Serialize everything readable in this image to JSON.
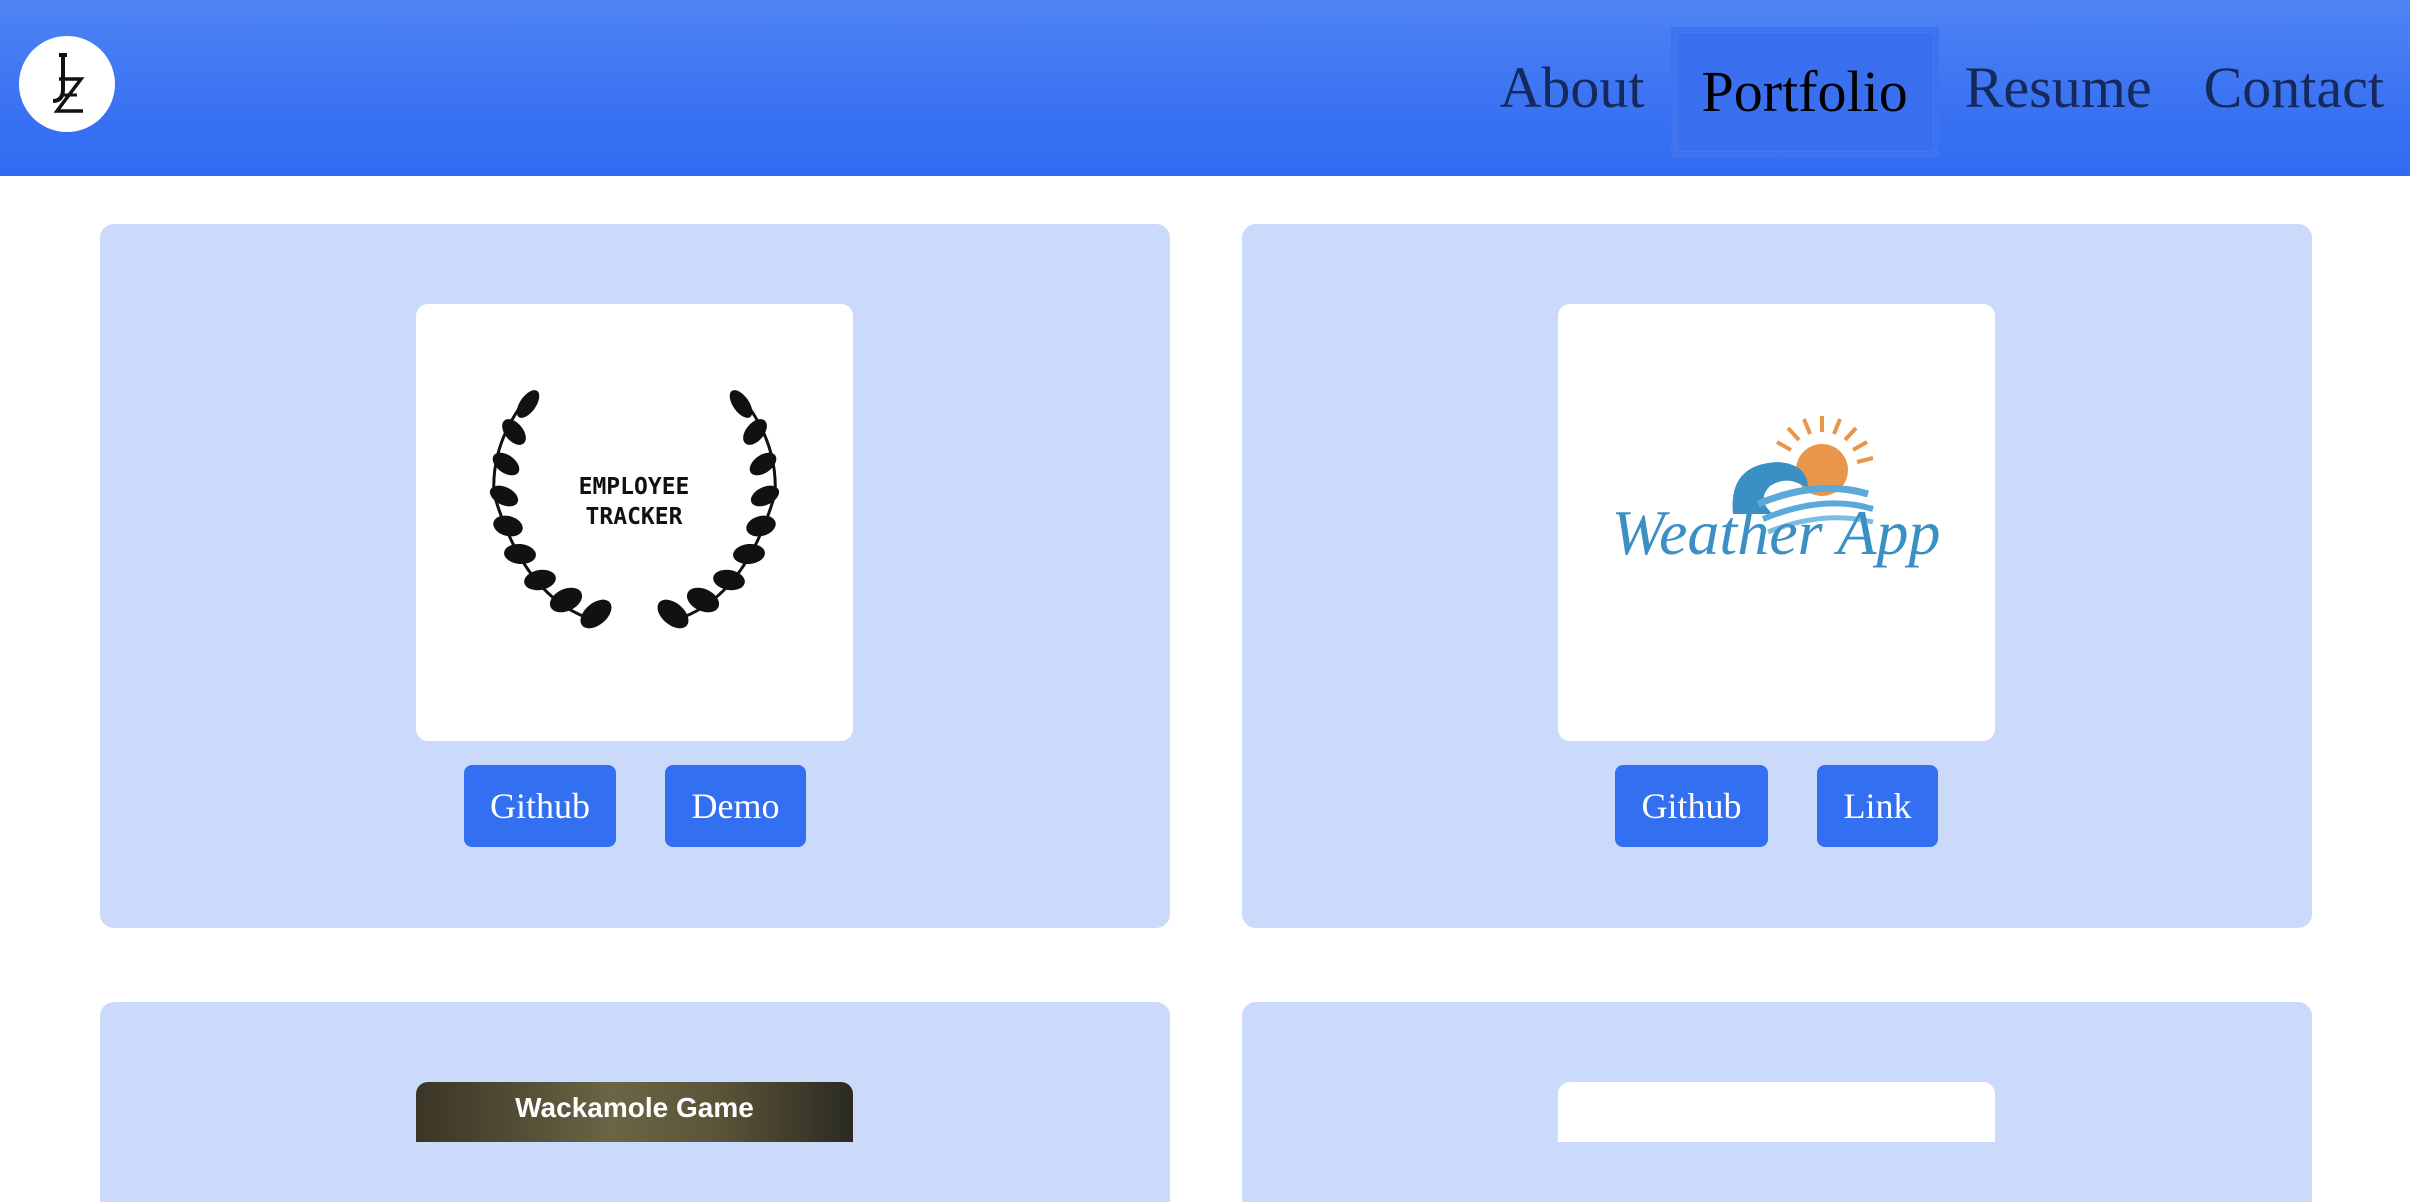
{
  "header": {
    "logo_text": "JZ",
    "nav": [
      {
        "label": "About"
      },
      {
        "label": "Portfolio",
        "active": true
      },
      {
        "label": "Resume"
      },
      {
        "label": "Contact"
      }
    ]
  },
  "projects": [
    {
      "logo_lines": [
        "EMPLOYEE",
        "TRACKER"
      ],
      "buttons": [
        "Github",
        "Demo"
      ]
    },
    {
      "logo_text": "Weather App",
      "buttons": [
        "Github",
        "Link"
      ]
    },
    {
      "thumb_title": "Wackamole Game"
    },
    {}
  ],
  "colors": {
    "header": "#3a72f2",
    "card": "#cbd9fa",
    "button": "#326ff1",
    "nav_text": "#15295b"
  }
}
